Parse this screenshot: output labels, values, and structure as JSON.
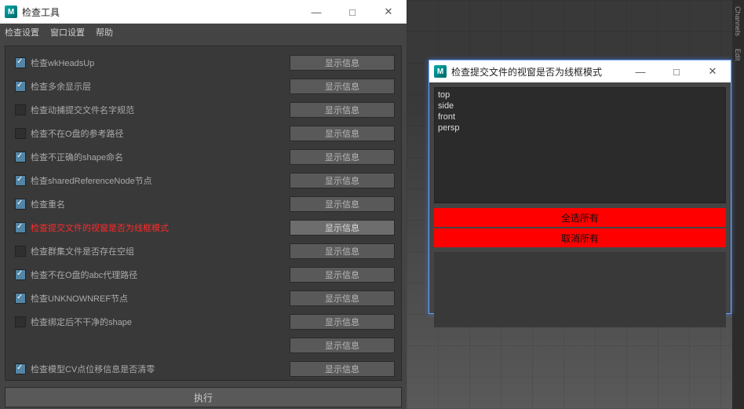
{
  "mainWindow": {
    "title": "检查工具",
    "logo": "M",
    "minimize": "—",
    "maximize": "□",
    "close": "✕",
    "menu": {
      "checkSettings": "检查设置",
      "windowSettings": "窗口设置",
      "help": "帮助"
    },
    "showInfoLabel": "显示信息",
    "runLabel": "执行",
    "rows": [
      {
        "label": "检查wkHeadsUp",
        "checked": true,
        "active": false
      },
      {
        "label": "检查多余显示层",
        "checked": true,
        "active": false
      },
      {
        "label": "检查动捕提交文件名字规范",
        "checked": false,
        "active": false
      },
      {
        "label": "检查不在O盘的参考路径",
        "checked": false,
        "active": false
      },
      {
        "label": "检查不正确的shape命名",
        "checked": true,
        "active": false
      },
      {
        "label": "检查sharedReferenceNode节点",
        "checked": true,
        "active": false
      },
      {
        "label": "检查重名",
        "checked": true,
        "active": false
      },
      {
        "label": "检查提交文件的视窗是否为线框模式",
        "checked": true,
        "active": true,
        "red": true
      },
      {
        "label": "检查群集文件是否存在空组",
        "checked": false,
        "active": false
      },
      {
        "label": "检查不在O盘的abc代理路径",
        "checked": true,
        "active": false
      },
      {
        "label": "检查UNKNOWNREF节点",
        "checked": true,
        "active": false
      },
      {
        "label": "检查绑定后不干净的shape",
        "checked": false,
        "active": false
      },
      {
        "label": "",
        "checked": null,
        "active": false
      },
      {
        "label": "检查模型CV点位移信息是否清零",
        "checked": true,
        "active": false
      }
    ]
  },
  "popup": {
    "title": "检查提交文件的视窗是否为线框模式",
    "logo": "M",
    "minimize": "—",
    "maximize": "□",
    "close": "✕",
    "items": [
      "top",
      "side",
      "front",
      "persp"
    ],
    "selectAll": "全选所有",
    "deselectAll": "取消所有"
  },
  "sideTabs": {
    "channels": "Channels",
    "edit": "Edit"
  }
}
